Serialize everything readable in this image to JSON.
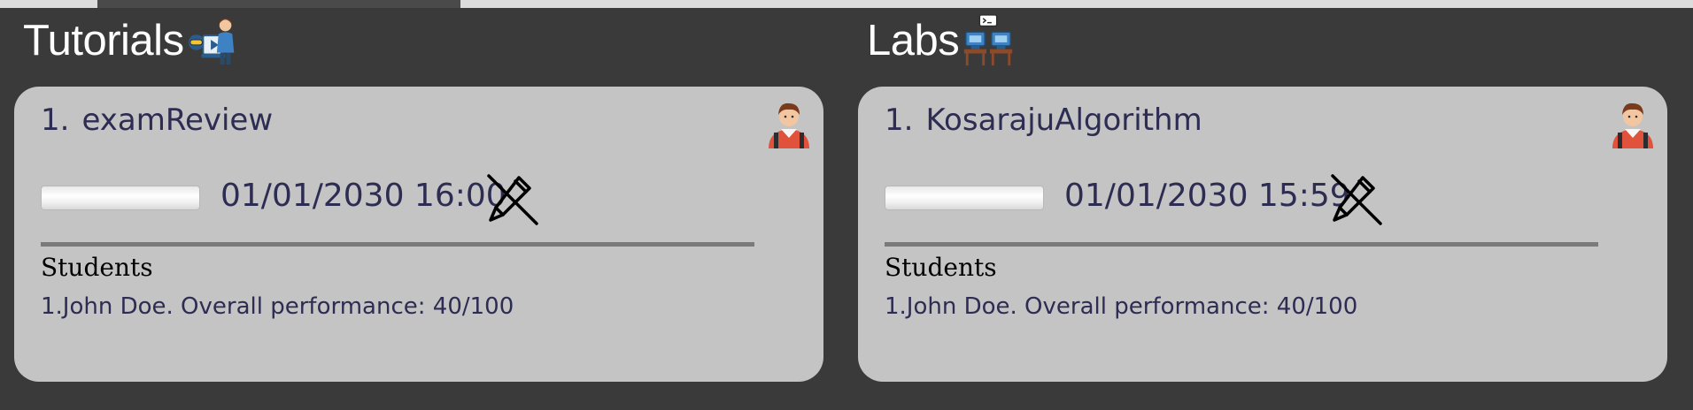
{
  "colors": {
    "background": "#3a3a3a",
    "card": "#c4c4c4",
    "text_primary": "#2d2c52",
    "heading": "#ffffff",
    "divider": "#7a7a7a"
  },
  "sections": [
    {
      "title": "Tutorials",
      "icon": "tutor-teaching-icon",
      "cards": [
        {
          "index": "1.",
          "name": "examReview",
          "avatar_icon": "student-avatar-icon",
          "progress": 0.0,
          "datetime": "01/01/2030 16:00",
          "edit_icon": "edit-off-icon",
          "students_heading": "Students",
          "students": [
            "1.John Doe. Overall performance: 40/100"
          ]
        }
      ]
    },
    {
      "title": "Labs",
      "icon": "lab-computers-icon",
      "cards": [
        {
          "index": "1.",
          "name": "KosarajuAlgorithm",
          "avatar_icon": "student-avatar-icon",
          "progress": 0.0,
          "datetime": "01/01/2030 15:59",
          "edit_icon": "edit-off-icon",
          "students_heading": "Students",
          "students": [
            "1.John Doe. Overall performance: 40/100"
          ]
        }
      ]
    }
  ]
}
